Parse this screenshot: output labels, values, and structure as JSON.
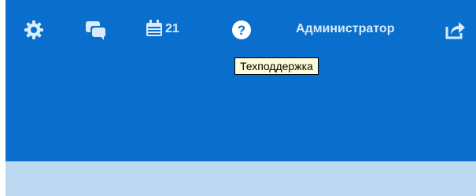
{
  "colors": {
    "header_background": "#0a6fcc",
    "header_icons": "#d9ebfb",
    "subheader_background": "#bcd9f1",
    "tooltip_background": "#fffcd9"
  },
  "header": {
    "icons": {
      "settings": "gear-icon",
      "messages": "chat-icon",
      "calendar": "calendar-icon",
      "help": "help-icon",
      "logout": "logout-share-icon"
    },
    "calendar_count": "21",
    "user_name": "Администратор"
  },
  "tooltip": {
    "text": "Техподдержка"
  }
}
